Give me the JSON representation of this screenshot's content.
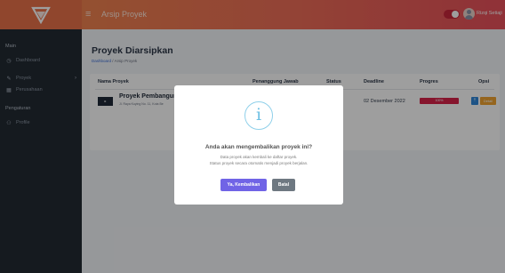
{
  "header": {
    "page_title": "Arsip Proyek",
    "user_name": "Rizqi Setiaji",
    "menu_icon": "hamburger-icon",
    "theme_toggle_on": true
  },
  "sidebar": {
    "section_main": "Main",
    "section_settings": "Pengaturan",
    "items": [
      {
        "label": "Dashboard",
        "icon": "dashboard-icon"
      },
      {
        "label": "Proyek",
        "icon": "pencil-icon"
      },
      {
        "label": "Perusahaan",
        "icon": "building-icon"
      },
      {
        "label": "Profile",
        "icon": "people-icon"
      }
    ]
  },
  "main": {
    "title": "Proyek Diarsipkan",
    "breadcrumb": {
      "home": "Dashboard",
      "separator": "/",
      "current": "Arsip Proyek"
    },
    "table": {
      "headers": [
        "Nama Proyek",
        "Penanggung Jawab",
        "Status",
        "Deadline",
        "Progres",
        "Opsi"
      ],
      "rows": [
        {
          "name": "Proyek Pembanguna",
          "address": "Jl. Raya Kuying No. 11, Kota Be",
          "deadline": "02 Desember 2022",
          "progress_label": "100%",
          "progress": 1.0,
          "detail_label": "Detail"
        }
      ]
    }
  },
  "modal": {
    "icon": "info-icon",
    "icon_glyph": "i",
    "title": "Anda akan mengembalikan proyek ini?",
    "text_1": "Data proyek akan kembali ke daftar proyek.",
    "text_2": "Status proyek secara otomatis menjadi proyek berjalan.",
    "confirm_label": "Ya, Kembalikan",
    "cancel_label": "Batal"
  },
  "colors": {
    "header_gradient_start": "#f08a4b",
    "header_gradient_end": "#e8505b",
    "sidebar_bg": "#222a33",
    "confirm_button": "#7064e6",
    "cancel_button": "#6e7881",
    "progress_fill": "#d9224a"
  }
}
